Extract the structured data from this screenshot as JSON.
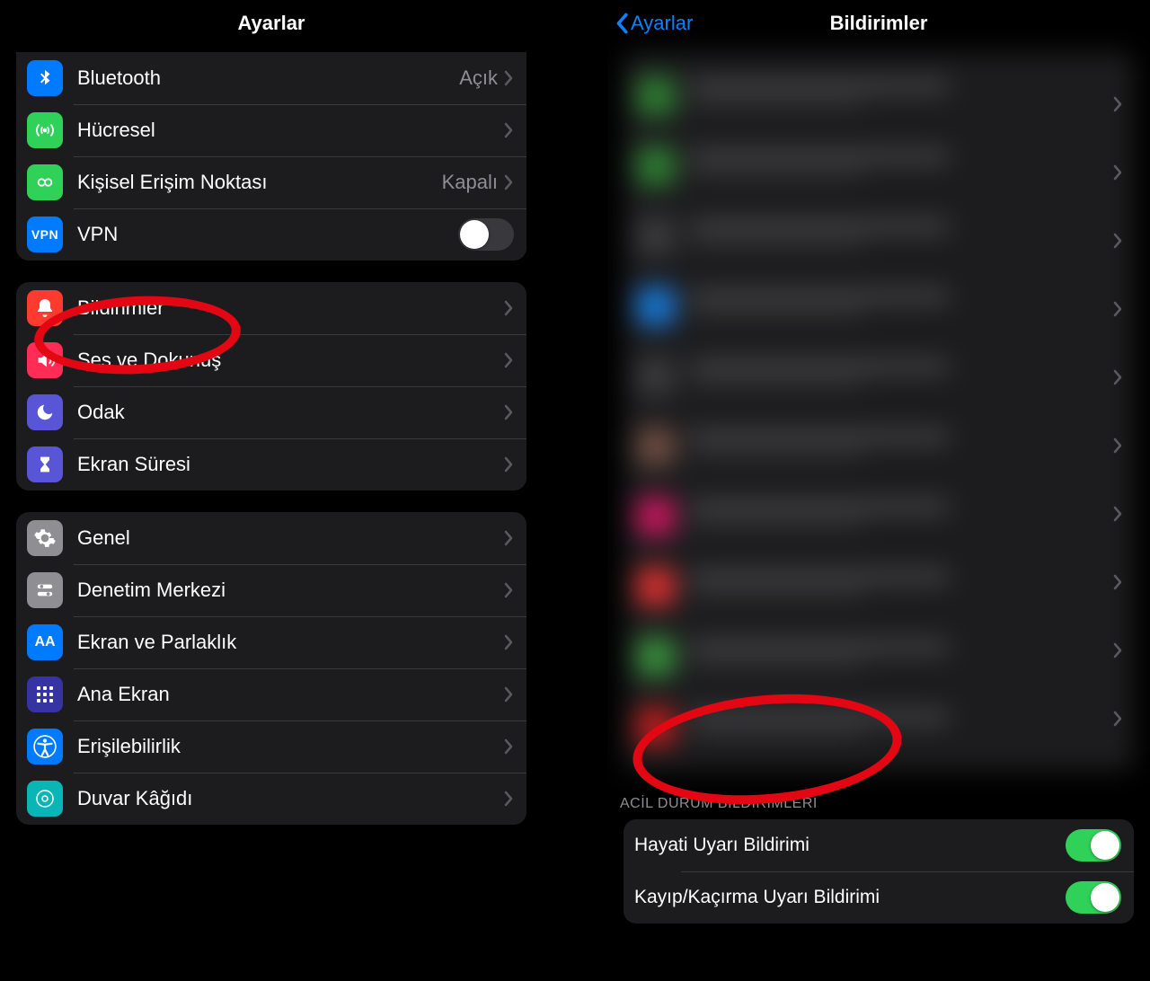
{
  "left": {
    "nav_title": "Ayarlar",
    "group1": [
      {
        "icon": "bluetooth",
        "color": "#007aff",
        "label": "Bluetooth",
        "value": "Açık",
        "chevron": true
      },
      {
        "icon": "cellular",
        "color": "#30d158",
        "label": "Hücresel",
        "chevron": true
      },
      {
        "icon": "hotspot",
        "color": "#30d158",
        "label": "Kişisel Erişim Noktası",
        "value": "Kapalı",
        "chevron": true
      },
      {
        "icon": "vpn",
        "color": "#007aff",
        "label": "VPN",
        "toggle": false
      }
    ],
    "group2": [
      {
        "icon": "bell",
        "color": "#ff3b30",
        "label": "Bildirimler",
        "chevron": true,
        "highlighted": true
      },
      {
        "icon": "speaker",
        "color": "#ff2d55",
        "label": "Ses ve Dokunuş",
        "chevron": true
      },
      {
        "icon": "moon",
        "color": "#5856d6",
        "label": "Odak",
        "chevron": true
      },
      {
        "icon": "hourglass",
        "color": "#5856d6",
        "label": "Ekran Süresi",
        "chevron": true
      }
    ],
    "group3": [
      {
        "icon": "gear",
        "color": "#8e8e93",
        "label": "Genel",
        "chevron": true
      },
      {
        "icon": "switches",
        "color": "#8e8e93",
        "label": "Denetim Merkezi",
        "chevron": true
      },
      {
        "icon": "aa",
        "color": "#007aff",
        "label": "Ekran ve Parlaklık",
        "chevron": true
      },
      {
        "icon": "grid",
        "color": "#3634a3",
        "label": "Ana Ekran",
        "chevron": true
      },
      {
        "icon": "accessibility",
        "color": "#007aff",
        "label": "Erişilebilirlik",
        "chevron": true
      },
      {
        "icon": "wallpaper",
        "color": "#0ab5b5",
        "label": "Duvar Kâğıdı",
        "chevron": true
      }
    ]
  },
  "right": {
    "nav_back": "Ayarlar",
    "nav_title": "Bildirimler",
    "blur_colors": [
      "#2e7d32",
      "#2e7d32",
      "#3a3a3c",
      "#1976d2",
      "#3a3a3c",
      "#6d4c41",
      "#c2185b",
      "#d32f2f",
      "#388e3c",
      "#b71c1c"
    ],
    "emergency_header": "ACİL DURUM BİLDİRİMLERİ",
    "emergency_items": [
      {
        "label": "Hayati Uyarı Bildirimi",
        "on": true,
        "highlighted": true
      },
      {
        "label": "Kayıp/Kaçırma Uyarı Bildirimi",
        "on": true
      }
    ]
  }
}
